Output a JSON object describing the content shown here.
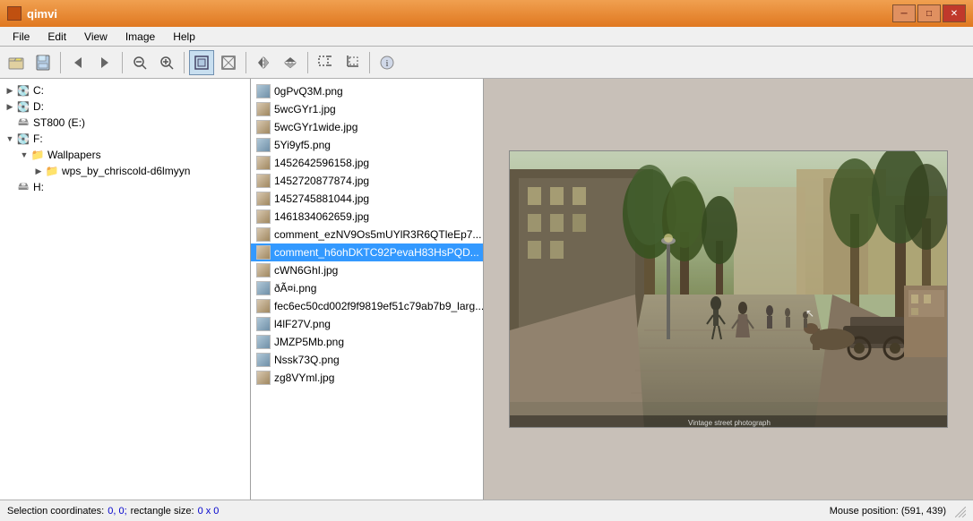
{
  "window": {
    "title": "qimvi",
    "icon": "app-icon"
  },
  "titlebar": {
    "controls": {
      "minimize": "─",
      "maximize": "□",
      "close": "✕"
    }
  },
  "menu": {
    "items": [
      {
        "label": "File",
        "id": "menu-file"
      },
      {
        "label": "Edit",
        "id": "menu-edit"
      },
      {
        "label": "View",
        "id": "menu-view"
      },
      {
        "label": "Image",
        "id": "menu-image"
      },
      {
        "label": "Help",
        "id": "menu-help"
      }
    ]
  },
  "toolbar": {
    "buttons": [
      {
        "label": "⬛",
        "title": "open",
        "id": "btn-open",
        "active": false
      },
      {
        "label": "💾",
        "title": "save",
        "id": "btn-save",
        "active": false
      },
      {
        "label": "◀",
        "title": "back",
        "id": "btn-back",
        "active": false
      },
      {
        "label": "▶",
        "title": "forward",
        "id": "btn-forward",
        "active": false
      },
      {
        "label": "sep1"
      },
      {
        "label": "🔍-",
        "title": "zoom-out",
        "id": "btn-zoom-out",
        "active": false
      },
      {
        "label": "🔍+",
        "title": "zoom-in",
        "id": "btn-zoom-in",
        "active": false
      },
      {
        "label": "sep2"
      },
      {
        "label": "⬜",
        "title": "normal-view",
        "id": "btn-normal",
        "active": true
      },
      {
        "label": "⊞",
        "title": "fit-view",
        "id": "btn-fit",
        "active": false
      },
      {
        "label": "sep3"
      },
      {
        "label": "↔",
        "title": "flip-h",
        "id": "btn-flip-h",
        "active": false
      },
      {
        "label": "↕",
        "title": "flip-v",
        "id": "btn-flip-v",
        "active": false
      },
      {
        "label": "sep4"
      },
      {
        "label": "⬛",
        "title": "crop1",
        "id": "btn-crop1",
        "active": false
      },
      {
        "label": "⊟",
        "title": "crop2",
        "id": "btn-crop2",
        "active": false
      },
      {
        "label": "sep5"
      },
      {
        "label": "◯",
        "title": "info",
        "id": "btn-info",
        "active": false
      }
    ]
  },
  "filetree": {
    "items": [
      {
        "label": "C:",
        "depth": 0,
        "type": "drive",
        "arrow": "▶",
        "expanded": false
      },
      {
        "label": "D:",
        "depth": 0,
        "type": "drive",
        "arrow": "▶",
        "expanded": false
      },
      {
        "label": "ST800 (E:)",
        "depth": 0,
        "type": "drive-hdd",
        "arrow": "",
        "expanded": false
      },
      {
        "label": "F:",
        "depth": 0,
        "type": "drive",
        "arrow": "▼",
        "expanded": true
      },
      {
        "label": "Wallpapers",
        "depth": 1,
        "type": "folder",
        "arrow": "▼",
        "expanded": true
      },
      {
        "label": "wps_by_chriscold-d6lmyyn",
        "depth": 2,
        "type": "folder",
        "arrow": "▶",
        "expanded": false
      },
      {
        "label": "H:",
        "depth": 0,
        "type": "drive-hdd",
        "arrow": "",
        "expanded": false
      }
    ]
  },
  "filelist": {
    "items": [
      {
        "name": "0gPvQ3M.png",
        "type": "png"
      },
      {
        "name": "5wcGYr1.jpg",
        "type": "jpg"
      },
      {
        "name": "5wcGYr1wide.jpg",
        "type": "jpg"
      },
      {
        "name": "5Yi9yf5.png",
        "type": "png"
      },
      {
        "name": "1452642596158.jpg",
        "type": "jpg"
      },
      {
        "name": "1452720877874.jpg",
        "type": "jpg"
      },
      {
        "name": "1452745881044.jpg",
        "type": "jpg"
      },
      {
        "name": "1461834062659.jpg",
        "type": "jpg"
      },
      {
        "name": "comment_ezNV9Os5mUYlR3R6QTleEp7...",
        "type": "jpg"
      },
      {
        "name": "comment_h6ohDKTC92PevaH83HsPQD...",
        "type": "jpg",
        "selected": true
      },
      {
        "name": "cWN6GhI.jpg",
        "type": "jpg"
      },
      {
        "name": "ðÃ¤i.png",
        "type": "png"
      },
      {
        "name": "fec6ec50cd002f9f9819ef51c79ab7b9_larg...",
        "type": "jpg"
      },
      {
        "name": "l4lF27V.png",
        "type": "png"
      },
      {
        "name": "JMZP5Mb.png",
        "type": "png"
      },
      {
        "name": "Nssk73Q.png",
        "type": "png"
      },
      {
        "name": "zg8VYml.jpg",
        "type": "jpg"
      }
    ]
  },
  "statusbar": {
    "selection_label": "Selection coordinates:",
    "selection_coords": "0, 0;",
    "rect_label": "rectangle size:",
    "rect_size": "0 x 0",
    "mouse_label": "Mouse position: (591, 439)"
  }
}
